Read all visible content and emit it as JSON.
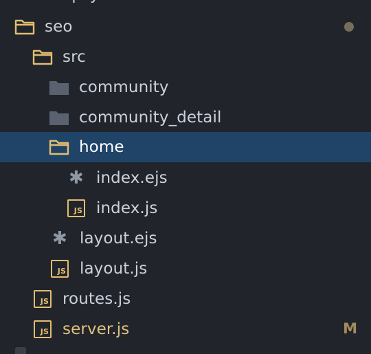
{
  "tree": {
    "partial_top_label": "q-sync",
    "items": [
      {
        "label": "seo",
        "icon": "folder-open-icon",
        "name": "tree-item-seo"
      },
      {
        "label": "src",
        "icon": "folder-open-icon",
        "name": "tree-item-src"
      },
      {
        "label": "community",
        "icon": "folder-closed-icon",
        "name": "tree-item-community"
      },
      {
        "label": "community_detail",
        "icon": "folder-closed-icon",
        "name": "tree-item-community-detail"
      },
      {
        "label": "home",
        "icon": "folder-open-icon",
        "name": "tree-item-home",
        "selected": true
      },
      {
        "label": "index.ejs",
        "icon": "ejs-file-icon",
        "name": "tree-item-index-ejs"
      },
      {
        "label": "index.js",
        "icon": "js-file-icon",
        "name": "tree-item-index-js"
      },
      {
        "label": "layout.ejs",
        "icon": "ejs-file-icon",
        "name": "tree-item-layout-ejs"
      },
      {
        "label": "layout.js",
        "icon": "js-file-icon",
        "name": "tree-item-layout-js"
      },
      {
        "label": "routes.js",
        "icon": "js-file-icon",
        "name": "tree-item-routes-js"
      },
      {
        "label": "server.js",
        "icon": "js-file-icon",
        "name": "tree-item-server-js",
        "status": "M"
      }
    ],
    "js_badge_text": "JS",
    "ejs_glyph": "✱"
  },
  "colors": {
    "background": "#21252b",
    "selected_row": "#1f4468",
    "text": "#cbd1dc",
    "folder_open_outline": "#e4bd6f",
    "folder_closed_fill": "#5a6270",
    "modified_text": "#e1c07f",
    "vcs_badge": "#a48c5c"
  }
}
